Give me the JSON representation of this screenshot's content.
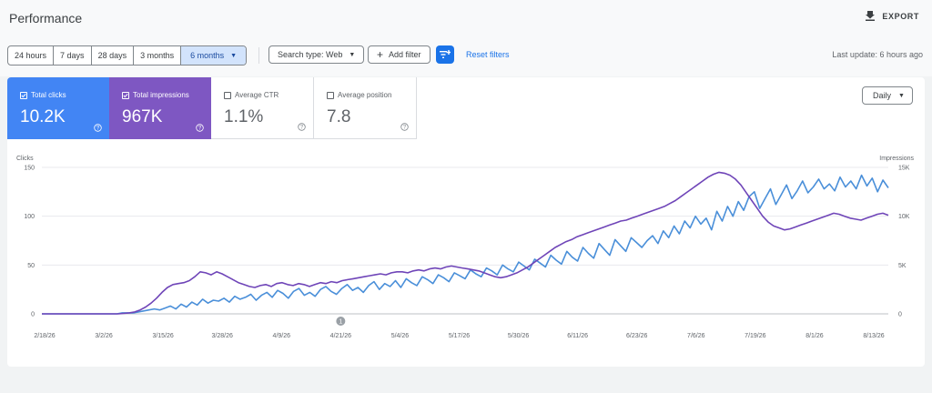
{
  "header": {
    "title": "Performance",
    "export_label": "EXPORT"
  },
  "filters": {
    "date_ranges": [
      "24 hours",
      "7 days",
      "28 days",
      "3 months",
      "6 months"
    ],
    "selected_range": "6 months",
    "search_type": "Search type: Web",
    "add_filter": "Add filter",
    "reset": "Reset filters",
    "last_update": "Last update: 6 hours ago"
  },
  "metrics": {
    "clicks": {
      "label": "Total clicks",
      "value": "10.2K",
      "checked": true,
      "color": "#4285f4"
    },
    "impressions": {
      "label": "Total impressions",
      "value": "967K",
      "checked": true,
      "color": "#7e57c2"
    },
    "ctr": {
      "label": "Average CTR",
      "value": "1.1%",
      "checked": false
    },
    "position": {
      "label": "Average position",
      "value": "7.8",
      "checked": false
    }
  },
  "granularity": "Daily",
  "chart_data": {
    "type": "line",
    "left_axis": {
      "label": "Clicks",
      "ticks": [
        "150",
        "100",
        "50",
        "0"
      ],
      "ylim": [
        0,
        150
      ]
    },
    "right_axis": {
      "label": "Impressions",
      "ticks": [
        "15K",
        "10K",
        "5K",
        "0"
      ],
      "ylim": [
        0,
        15000
      ]
    },
    "x_tick_labels": [
      "2/18/26",
      "3/2/26",
      "3/15/26",
      "3/28/26",
      "4/9/26",
      "4/21/26",
      "5/4/26",
      "5/17/26",
      "5/30/26",
      "6/11/26",
      "6/23/26",
      "7/6/26",
      "7/19/26",
      "8/1/26",
      "8/13/26"
    ],
    "annotation": {
      "label": "1",
      "date": "4/21/26"
    },
    "grid": true,
    "series": [
      {
        "name": "Total clicks",
        "axis": "left",
        "color": "#4a8fd9",
        "values": [
          0,
          0,
          0,
          0,
          0,
          0,
          0,
          0,
          0,
          0,
          0,
          0,
          0,
          0,
          0,
          1,
          1,
          1,
          2,
          3,
          4,
          5,
          4,
          6,
          8,
          5,
          10,
          7,
          12,
          9,
          15,
          11,
          14,
          13,
          16,
          12,
          18,
          15,
          17,
          20,
          14,
          19,
          22,
          17,
          24,
          21,
          16,
          23,
          26,
          19,
          22,
          18,
          25,
          28,
          23,
          20,
          26,
          30,
          24,
          27,
          22,
          29,
          33,
          25,
          31,
          28,
          34,
          27,
          36,
          32,
          29,
          38,
          35,
          31,
          40,
          37,
          33,
          42,
          39,
          36,
          45,
          41,
          38,
          47,
          44,
          40,
          50,
          46,
          43,
          53,
          49,
          45,
          56,
          52,
          48,
          60,
          55,
          51,
          64,
          58,
          54,
          68,
          62,
          57,
          72,
          66,
          60,
          76,
          70,
          64,
          78,
          73,
          68,
          75,
          80,
          72,
          85,
          78,
          90,
          82,
          95,
          88,
          100,
          92,
          98,
          86,
          105,
          95,
          110,
          100,
          115,
          106,
          120,
          125,
          108,
          118,
          128,
          112,
          122,
          132,
          118,
          126,
          136,
          124,
          130,
          138,
          128,
          133,
          126,
          140,
          130,
          136,
          128,
          142,
          131,
          139,
          125,
          137,
          129
        ]
      },
      {
        "name": "Total impressions",
        "axis": "right",
        "color": "#6f45b8",
        "values": [
          0,
          0,
          0,
          0,
          0,
          0,
          0,
          0,
          0,
          0,
          0,
          0,
          0,
          0,
          0,
          50,
          100,
          200,
          400,
          700,
          1100,
          1600,
          2200,
          2700,
          3000,
          3100,
          3200,
          3400,
          3800,
          4300,
          4200,
          4000,
          4300,
          4100,
          3800,
          3500,
          3200,
          3000,
          2800,
          2700,
          2900,
          3000,
          2800,
          3100,
          3200,
          3000,
          2900,
          3100,
          3000,
          2800,
          3000,
          3200,
          3100,
          3300,
          3200,
          3400,
          3500,
          3600,
          3700,
          3800,
          3900,
          4000,
          4100,
          4000,
          4200,
          4300,
          4300,
          4200,
          4400,
          4500,
          4400,
          4600,
          4700,
          4600,
          4800,
          4900,
          4800,
          4700,
          4600,
          4500,
          4400,
          4200,
          4000,
          3800,
          3700,
          3800,
          4000,
          4200,
          4500,
          4800,
          5200,
          5600,
          6000,
          6400,
          6800,
          7100,
          7400,
          7600,
          7900,
          8100,
          8300,
          8500,
          8700,
          8900,
          9100,
          9300,
          9500,
          9600,
          9800,
          10000,
          10200,
          10400,
          10600,
          10800,
          11000,
          11300,
          11600,
          12000,
          12400,
          12800,
          13200,
          13600,
          14000,
          14300,
          14500,
          14400,
          14200,
          13800,
          13200,
          12400,
          11600,
          10800,
          10000,
          9400,
          9000,
          8800,
          8600,
          8700,
          8900,
          9100,
          9300,
          9500,
          9700,
          9900,
          10100,
          10300,
          10200,
          10000,
          9800,
          9700,
          9600,
          9800,
          10000,
          10200,
          10300,
          10100
        ]
      }
    ]
  }
}
